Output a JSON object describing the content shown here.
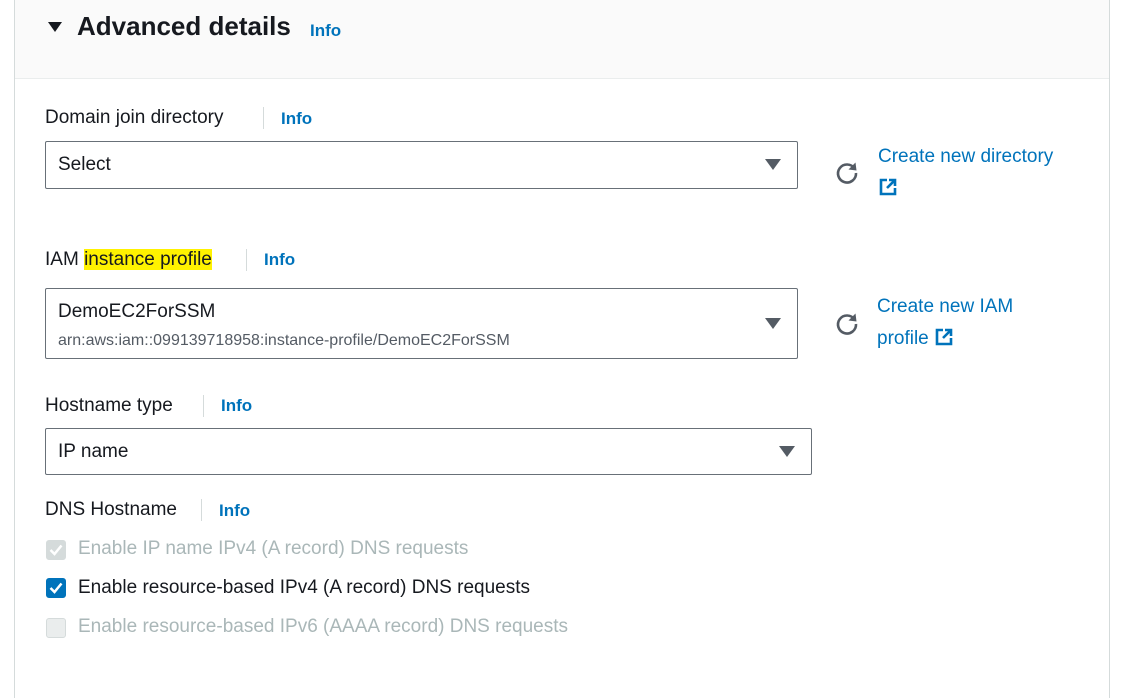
{
  "section": {
    "title": "Advanced details",
    "info": "Info"
  },
  "domain_join": {
    "label": "Domain join directory",
    "info": "Info",
    "value": "Select",
    "create_link": "Create new directory"
  },
  "iam": {
    "label_prefix": "IAM ",
    "label_highlight": "instance profile",
    "info": "Info",
    "value": "DemoEC2ForSSM",
    "arn": "arn:aws:iam::099139718958:instance-profile/DemoEC2ForSSM",
    "create_link_line1": "Create new IAM",
    "create_link_line2": "profile"
  },
  "hostname_type": {
    "label": "Hostname type",
    "info": "Info",
    "value": "IP name"
  },
  "dns_hostname": {
    "label": "DNS Hostname",
    "info": "Info",
    "options": [
      {
        "label": "Enable IP name IPv4 (A record) DNS requests",
        "checked": true,
        "disabled": true
      },
      {
        "label": "Enable resource-based IPv4 (A record) DNS requests",
        "checked": true,
        "disabled": false
      },
      {
        "label": "Enable resource-based IPv6 (AAAA record) DNS requests",
        "checked": false,
        "disabled": true
      }
    ]
  },
  "colors": {
    "link": "#0073bb",
    "highlight": "#fff200",
    "checkbox_checked": "#0073bb",
    "disabled_text": "#aab7b8"
  },
  "icons": {
    "section_toggle": "caret-down-icon",
    "select_caret": "caret-down-icon",
    "refresh": "refresh-icon",
    "external": "external-link-icon"
  }
}
